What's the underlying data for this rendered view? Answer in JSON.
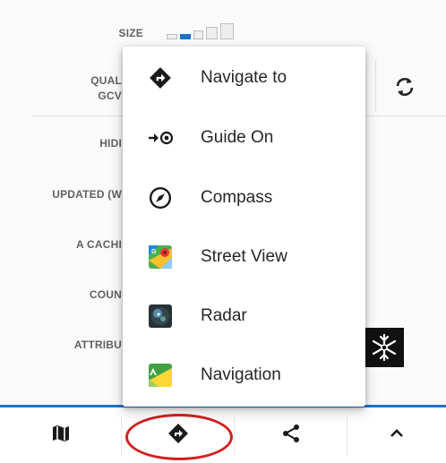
{
  "details": {
    "size_label": "SIZE",
    "quality_label_1": "QUAL",
    "quality_label_2": "GCV",
    "hidden_label": "HIDI",
    "updated_label": "UPDATED (W",
    "cache_label": "A CACHI",
    "count_label": "COUN",
    "attribute_label": "ATTRIBU"
  },
  "menu": {
    "items": [
      {
        "label": "Navigate to",
        "icon": "navigate-diamond-icon"
      },
      {
        "label": "Guide On",
        "icon": "guide-on-icon"
      },
      {
        "label": "Compass",
        "icon": "compass-icon"
      },
      {
        "label": "Street View",
        "icon": "street-view-icon"
      },
      {
        "label": "Radar",
        "icon": "radar-icon"
      },
      {
        "label": "Navigation",
        "icon": "navigation-maps-icon"
      }
    ]
  },
  "bottom_bar": {
    "tabs": [
      "map-icon",
      "navigate-diamond-icon",
      "share-icon",
      "chevron-up-icon"
    ],
    "accent_color": "#1e73c8",
    "highlight_color": "#d42020"
  }
}
